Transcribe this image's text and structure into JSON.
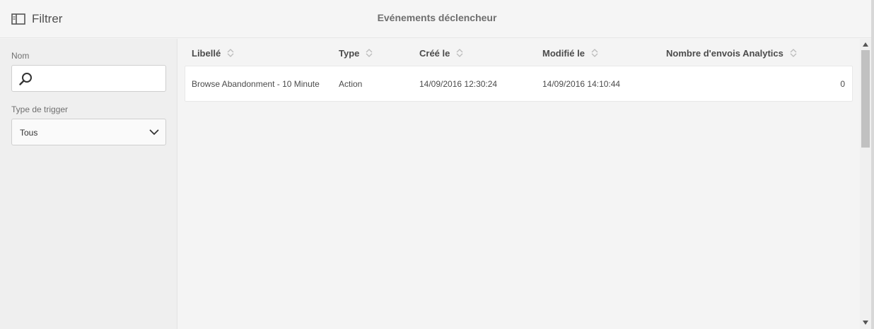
{
  "toolbar": {
    "filter_label": "Filtrer",
    "page_title": "Evénements déclencheur"
  },
  "filters": {
    "name_label": "Nom",
    "name_value": "",
    "trigger_type_label": "Type de trigger",
    "trigger_type_value": "Tous"
  },
  "table": {
    "columns": [
      "Libellé",
      "Type",
      "Créé le",
      "Modifié le",
      "Nombre d'envois Analytics"
    ],
    "rows": [
      {
        "label": "Browse Abandonment - 10 Minute",
        "type": "Action",
        "created": "14/09/2016 12:30:24",
        "modified": "14/09/2016 14:10:44",
        "analytics_sends": "0"
      }
    ]
  },
  "icons": {
    "filter_toggle": "sidebar-panel-icon",
    "search": "magnifier-icon",
    "dropdown": "chevron-down-icon",
    "sort": "sort-arrows-icon"
  }
}
